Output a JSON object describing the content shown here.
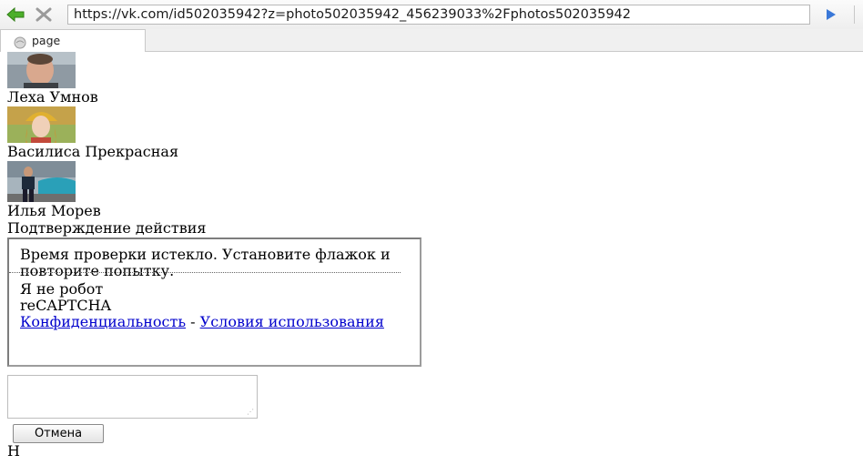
{
  "browser": {
    "url": "https://vk.com/id502035942?z=photo502035942_456239033%2Fphotos502035942",
    "tab_label": "page"
  },
  "icons": {
    "back": "back-arrow-icon",
    "stop": "stop-x-icon",
    "go": "go-arrow-icon",
    "tab": "page-globe-icon"
  },
  "people": [
    {
      "name": "Леха Умнов",
      "avatar": "avatar-man-portrait"
    },
    {
      "name": "Василиса Прекрасная",
      "avatar": "avatar-woman-kokoshnik"
    },
    {
      "name": "Илья Морев",
      "avatar": "avatar-man-with-car"
    }
  ],
  "confirm": {
    "title": "Подтверждение действия",
    "message": "Время проверки истекло. Установите флажок и повторите попытку.",
    "checkbox_label": "Я не робот",
    "brand": "reCAPTCHA",
    "privacy_link": "Конфиденциальность",
    "link_separator": " - ",
    "terms_link": "Условия использования",
    "cancel_label": "Отмена",
    "trailing_text": "Н"
  },
  "colors": {
    "link": "#0000cc",
    "back_arrow": "#4caf2a",
    "go_arrow": "#3a78d8"
  }
}
